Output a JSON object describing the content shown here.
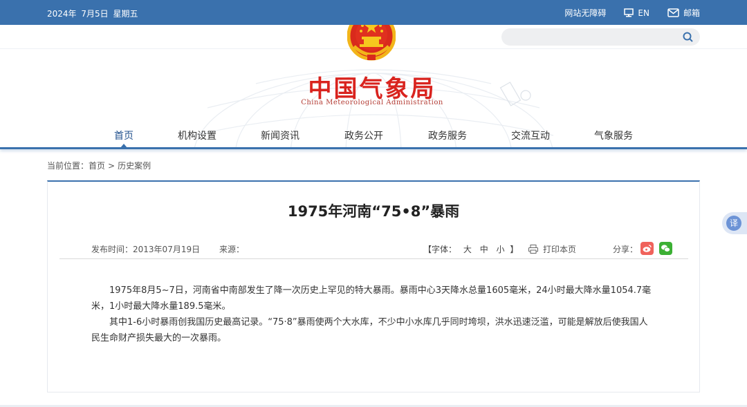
{
  "topbar": {
    "date": "2024年  7月5日  星期五",
    "accessibility": "网站无障碍",
    "language": "EN",
    "mail": "邮箱"
  },
  "search": {
    "placeholder": ""
  },
  "site": {
    "title_cn": "中国气象局",
    "title_en": "China Meteorological Administration"
  },
  "nav": {
    "items": [
      "首页",
      "机构设置",
      "新闻资讯",
      "政务公开",
      "政务服务",
      "交流互动",
      "气象服务"
    ],
    "active": "首页"
  },
  "breadcrumb": {
    "label": "当前位置：",
    "home": "首页",
    "separator": ">",
    "current": "历史案例"
  },
  "article": {
    "title": "1975年河南“75•8”暴雨",
    "publish_label": "发布时间：",
    "publish_date": "2013年07月19日",
    "source_label": "来源：",
    "font_label": "【字体：",
    "font_large": "大",
    "font_medium": "中",
    "font_small": "小",
    "font_close": "】",
    "print_label": "打印本页",
    "share_label": "分享：",
    "paragraphs": [
      "1975年8月5~7日，河南省中南部发生了降一次历史上罕见的特大暴雨。暴雨中心3天降水总量1605毫米，24小时最大降水量1054.7毫米，1小时最大降水量189.5毫米。",
      "其中1-6小时暴雨创我国历史最高记录。“75·8”暴雨使两个大水库，不少中小水库几乎同时垮坝，洪水迅速泛滥，可能是解放后使我国人民生命财产损失最大的一次暴雨。"
    ]
  },
  "translate": {
    "label": "译"
  },
  "colors": {
    "topbar": "#3a71ad",
    "title_red": "#d9231e",
    "nav_active": "#1f4f8c",
    "weibo": "#f0625b",
    "wechat": "#3cb034"
  },
  "icons": [
    "accessibility-icon",
    "monitor-icon",
    "mail-icon",
    "search-icon",
    "national-emblem",
    "printer-icon",
    "weibo-icon",
    "wechat-icon",
    "translate-icon"
  ]
}
